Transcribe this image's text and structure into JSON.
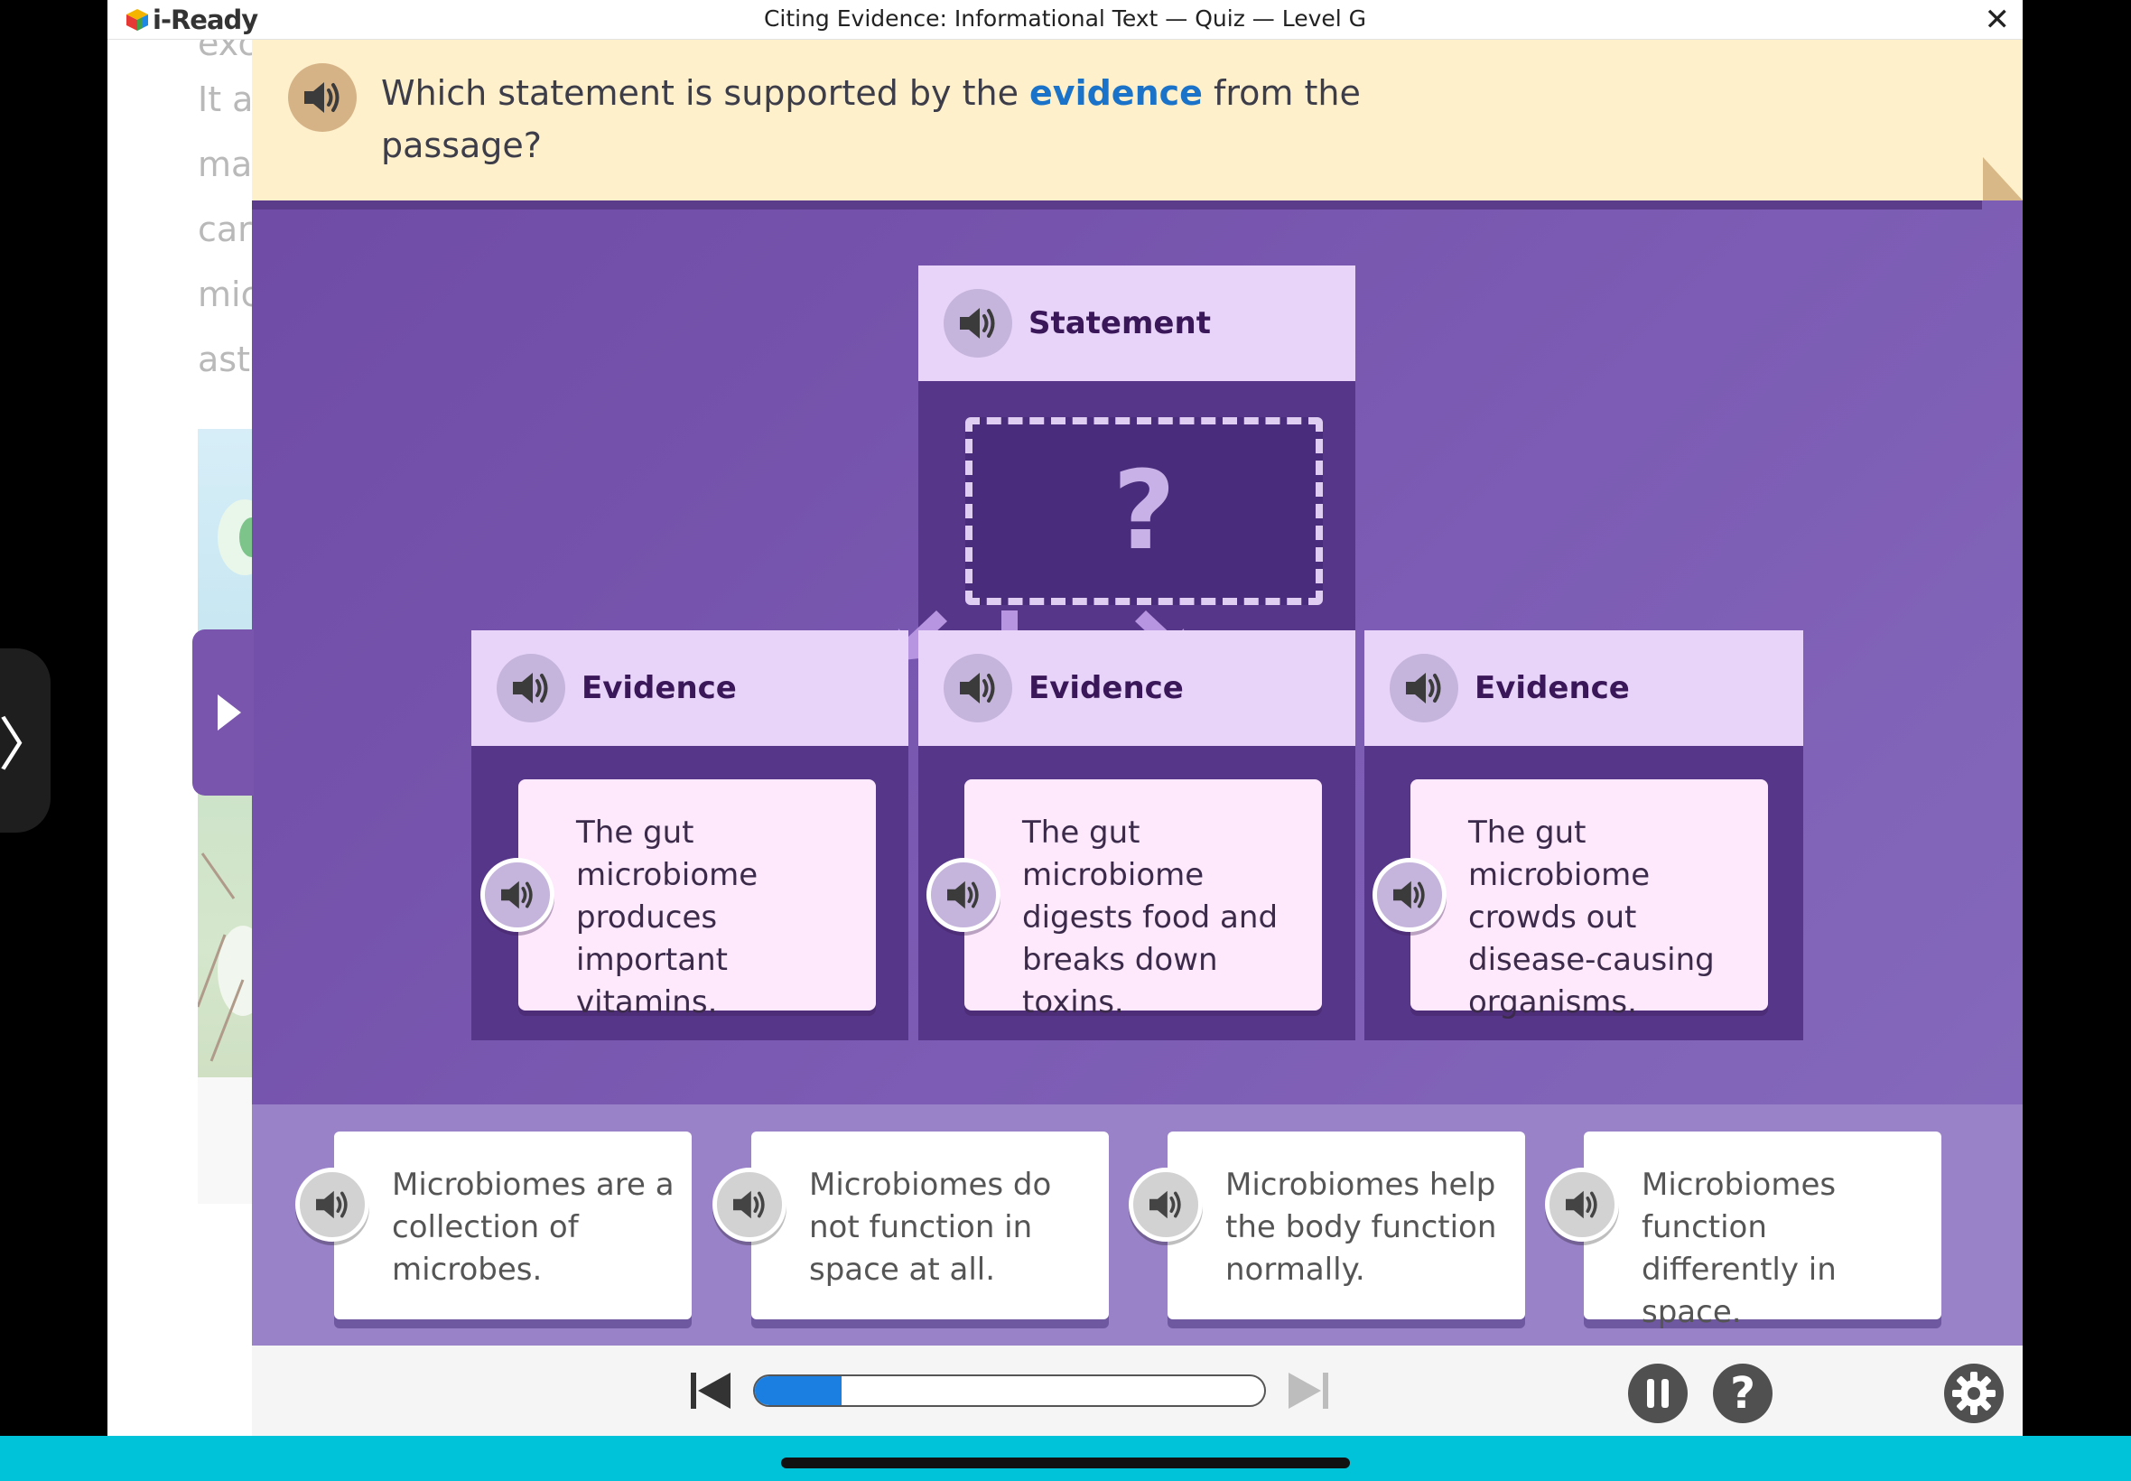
{
  "app": {
    "logo_text": "i-Ready",
    "window_title": "Citing Evidence: Informational Text — Quiz — Level G",
    "close_glyph": "✕"
  },
  "side_tab": {
    "glyph": "〉"
  },
  "passage": {
    "lines": [
      "exc",
      "It a",
      "ma",
      "car",
      "mic",
      "ast"
    ]
  },
  "question": {
    "text_before": "Which statement is supported by the ",
    "highlight": "evidence",
    "text_after": " from the passage?"
  },
  "diagram": {
    "statement_label": "Statement",
    "drop_placeholder": "?",
    "evidence": [
      {
        "label": "Evidence",
        "text": "The gut microbiome produces important vitamins."
      },
      {
        "label": "Evidence",
        "text": "The gut microbiome digests food and breaks down toxins."
      },
      {
        "label": "Evidence",
        "text": "The gut microbiome crowds out disease-causing organisms."
      }
    ]
  },
  "options": [
    {
      "text": "Microbiomes are a collection of microbes."
    },
    {
      "text": "Microbiomes do not function in space at all."
    },
    {
      "text": "Microbiomes help the body function normally."
    },
    {
      "text": "Microbiomes function differently in space."
    }
  ],
  "controls": {
    "progress_fraction": 0.17,
    "help_glyph": "?"
  },
  "colors": {
    "accent_blue": "#1a73c9",
    "main_purple": "#7c5cb4",
    "question_bar": "#fdf0cb",
    "bottom_bar": "#00c3d9"
  },
  "icons": [
    "speaker-icon",
    "question-mark-icon",
    "play-triangle-icon",
    "skip-back-icon",
    "skip-forward-icon",
    "pause-icon",
    "help-icon",
    "gear-icon",
    "close-icon"
  ]
}
